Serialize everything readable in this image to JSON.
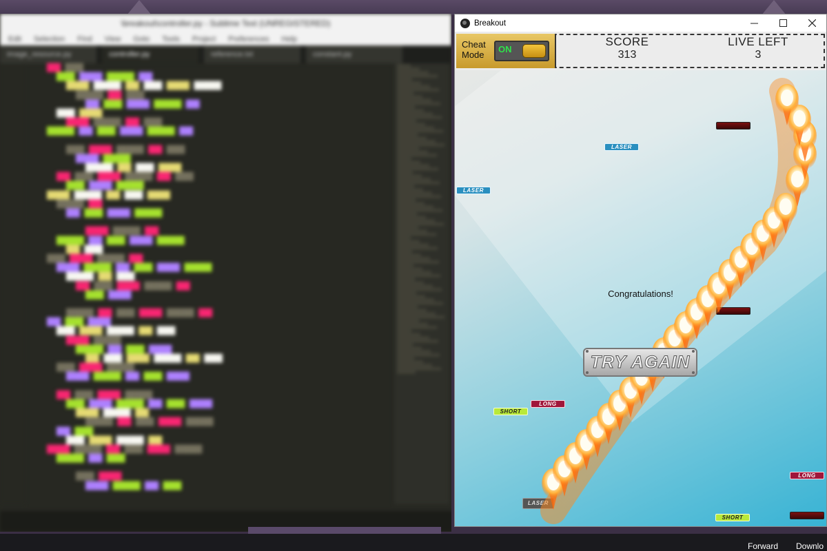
{
  "editor": {
    "title": "\\breakout\\controller.py - Sublime Text (UNREGISTERED)",
    "menu": [
      "Edit",
      "Selection",
      "Find",
      "View",
      "Goto",
      "Tools",
      "Project",
      "Preferences",
      "Help"
    ],
    "tabs": [
      "image_resource.py",
      "controller.py",
      "reference.txt",
      "constant.py"
    ],
    "active_tab": 1,
    "status_left": "",
    "status_right": ""
  },
  "taskbar": {
    "forward": "Forward",
    "download": "Downlo"
  },
  "game": {
    "window_title": "Breakout",
    "cheat_label": "Cheat Mode",
    "cheat_state": "ON",
    "score_label": "SCORE",
    "score_value": "313",
    "lives_label": "LIVE LEFT",
    "lives_value": "3",
    "message": "Congratulations!",
    "try_again": "TRY AGAIN",
    "powerups": [
      {
        "type": "laser",
        "label": "LASER"
      },
      {
        "type": "laser",
        "label": "LASER"
      },
      {
        "type": "long",
        "label": "LONG"
      },
      {
        "type": "long",
        "label": "LONG"
      },
      {
        "type": "short",
        "label": "SHORT"
      },
      {
        "type": "short",
        "label": "SHORT"
      },
      {
        "type": "grey",
        "label": "LASER"
      }
    ]
  },
  "colors": {
    "hud_bg": "#ececec",
    "cheat_gold": "#d8ad45",
    "toggle_on": "#2ee34a",
    "arena_top": "#e7e8e6",
    "arena_bottom": "#38b3d4",
    "flame": "#ff8a1e"
  },
  "icons": {
    "app": "breakout-ball-icon",
    "minimize": "minimize-icon",
    "maximize": "maximize-icon",
    "close": "close-icon"
  }
}
